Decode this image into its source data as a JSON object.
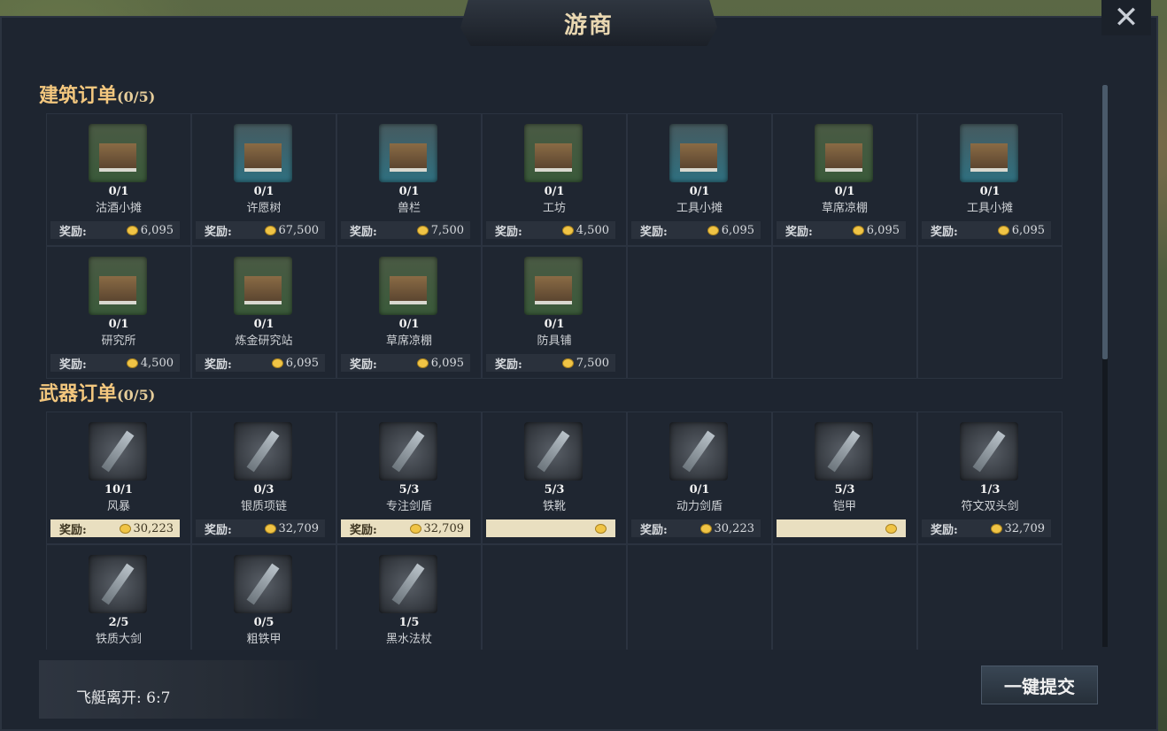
{
  "title": "游商",
  "sections": [
    {
      "title": "建筑订单",
      "count": "(0/5)",
      "items": [
        {
          "progress": "0/1",
          "name": "沽酒小摊",
          "reward_label": "奖励:",
          "reward": "6,095",
          "bg": "green"
        },
        {
          "progress": "0/1",
          "name": "许愿树",
          "reward_label": "奖励:",
          "reward": "67,500",
          "bg": "blue"
        },
        {
          "progress": "0/1",
          "name": "兽栏",
          "reward_label": "奖励:",
          "reward": "7,500",
          "bg": "blue"
        },
        {
          "progress": "0/1",
          "name": "工坊",
          "reward_label": "奖励:",
          "reward": "4,500",
          "bg": "green"
        },
        {
          "progress": "0/1",
          "name": "工具小摊",
          "reward_label": "奖励:",
          "reward": "6,095",
          "bg": "blue"
        },
        {
          "progress": "0/1",
          "name": "草席凉棚",
          "reward_label": "奖励:",
          "reward": "6,095",
          "bg": "green"
        },
        {
          "progress": "0/1",
          "name": "工具小摊",
          "reward_label": "奖励:",
          "reward": "6,095",
          "bg": "blue"
        },
        {
          "progress": "0/1",
          "name": "研究所",
          "reward_label": "奖励:",
          "reward": "4,500",
          "bg": "green"
        },
        {
          "progress": "0/1",
          "name": "炼金研究站",
          "reward_label": "奖励:",
          "reward": "6,095",
          "bg": "green"
        },
        {
          "progress": "0/1",
          "name": "草席凉棚",
          "reward_label": "奖励:",
          "reward": "6,095",
          "bg": "green"
        },
        {
          "progress": "0/1",
          "name": "防具铺",
          "reward_label": "奖励:",
          "reward": "7,500",
          "bg": "green"
        }
      ]
    },
    {
      "title": "武器订单",
      "count": "(0/5)",
      "items": [
        {
          "progress": "10/1",
          "name": "风暴",
          "reward_label": "奖励:",
          "reward": "30,223",
          "highlight": true,
          "bg": "dark",
          "icon": "blue-blade-icon"
        },
        {
          "progress": "0/3",
          "name": "银质项链",
          "reward_label": "奖励:",
          "reward": "32,709",
          "bg": "dark",
          "icon": "necklace-icon"
        },
        {
          "progress": "5/3",
          "name": "专注剑盾",
          "reward_label": "奖励:",
          "reward": "32,709",
          "highlight": true,
          "bg": "dark",
          "icon": "sword-shield-icon"
        },
        {
          "progress": "5/3",
          "name": "铁靴",
          "reward_label": "",
          "reward": "",
          "highlight": true,
          "bg": "dark",
          "icon": "boots-icon"
        },
        {
          "progress": "0/1",
          "name": "动力剑盾",
          "reward_label": "奖励:",
          "reward": "30,223",
          "bg": "dark",
          "icon": "pink-sword-shield-icon"
        },
        {
          "progress": "5/3",
          "name": "铠甲",
          "reward_label": "",
          "reward": "",
          "highlight": true,
          "bg": "dark",
          "icon": "armor-icon"
        },
        {
          "progress": "1/3",
          "name": "符文双头剑",
          "reward_label": "奖励:",
          "reward": "32,709",
          "bg": "dark",
          "icon": "double-sword-icon"
        },
        {
          "progress": "2/5",
          "name": "铁质大剑",
          "reward_label": "",
          "reward": "",
          "bg": "dark",
          "icon": "greatsword-icon"
        },
        {
          "progress": "0/5",
          "name": "粗铁甲",
          "reward_label": "",
          "reward": "",
          "bg": "dark",
          "icon": "iron-armor-icon"
        },
        {
          "progress": "1/5",
          "name": "黑水法杖",
          "reward_label": "",
          "reward": "",
          "bg": "dark",
          "icon": "staff-icon"
        }
      ]
    }
  ],
  "footer": {
    "departure": "飞艇离开: 6:7",
    "submit_label": "一键提交"
  },
  "close_icon": "close-icon"
}
